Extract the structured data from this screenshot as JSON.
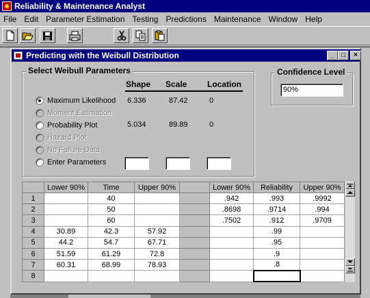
{
  "app": {
    "title": "Reliability & Maintenance Analyst"
  },
  "menu": [
    "File",
    "Edit",
    "Parameter Estimation",
    "Testing",
    "Predictions",
    "Maintenance",
    "Window",
    "Help"
  ],
  "toolbar": {
    "buttons": [
      "new-document-icon",
      "open-folder-icon",
      "save-disk-icon",
      "print-icon",
      "cut-scissors-icon",
      "copy-icon",
      "paste-icon"
    ]
  },
  "dialog": {
    "title": "Predicting with the Weibull Distribution",
    "params_group_label": "Select Weibull Parameters",
    "headers": {
      "shape": "Shape",
      "scale": "Scale",
      "location": "Location"
    },
    "options": [
      {
        "label": "Maximum Likelihood",
        "checked": true,
        "enabled": true,
        "shape": "6.336",
        "scale": "87.42",
        "location": "0"
      },
      {
        "label": "Moment Estimation",
        "checked": false,
        "enabled": false,
        "shape": "",
        "scale": "",
        "location": ""
      },
      {
        "label": "Probability Plot",
        "checked": false,
        "enabled": true,
        "shape": "5.034",
        "scale": "89.89",
        "location": "0"
      },
      {
        "label": "Hazard Plot",
        "checked": false,
        "enabled": false,
        "shape": "",
        "scale": "",
        "location": ""
      },
      {
        "label": "No Failure Data",
        "checked": false,
        "enabled": false,
        "shape": "",
        "scale": "",
        "location": ""
      },
      {
        "label": "Enter Parameters",
        "checked": false,
        "enabled": true,
        "shape": "",
        "scale": "",
        "location": ""
      }
    ],
    "confidence_group_label": "Confidence Level",
    "confidence_value": "90%"
  },
  "grid": {
    "columns": [
      "Lower 90%",
      "Time",
      "Upper 90%",
      "",
      "Lower 90%",
      "Reliability",
      "Upper 90%"
    ],
    "rows": [
      {
        "num": "1",
        "cells": [
          "",
          "40",
          "",
          "",
          ".942",
          ".993",
          ".9992"
        ]
      },
      {
        "num": "2",
        "cells": [
          "",
          "50",
          "",
          "",
          ".8698",
          ".9714",
          ".994"
        ]
      },
      {
        "num": "3",
        "cells": [
          "",
          "60",
          "",
          "",
          ".7502",
          ".912",
          ".9709"
        ]
      },
      {
        "num": "4",
        "cells": [
          "30.89",
          "42.3",
          "57.92",
          "",
          "",
          ".99",
          ""
        ]
      },
      {
        "num": "5",
        "cells": [
          "44.2",
          "54.7",
          "67.71",
          "",
          "",
          ".95",
          ""
        ]
      },
      {
        "num": "6",
        "cells": [
          "51.59",
          "61.29",
          "72.8",
          "",
          "",
          ".9",
          ""
        ]
      },
      {
        "num": "7",
        "cells": [
          "60.31",
          "68.99",
          "78.93",
          "",
          "",
          ".8",
          ""
        ]
      },
      {
        "num": "8",
        "cells": [
          "",
          "",
          "",
          "",
          "",
          "",
          ""
        ]
      }
    ]
  }
}
